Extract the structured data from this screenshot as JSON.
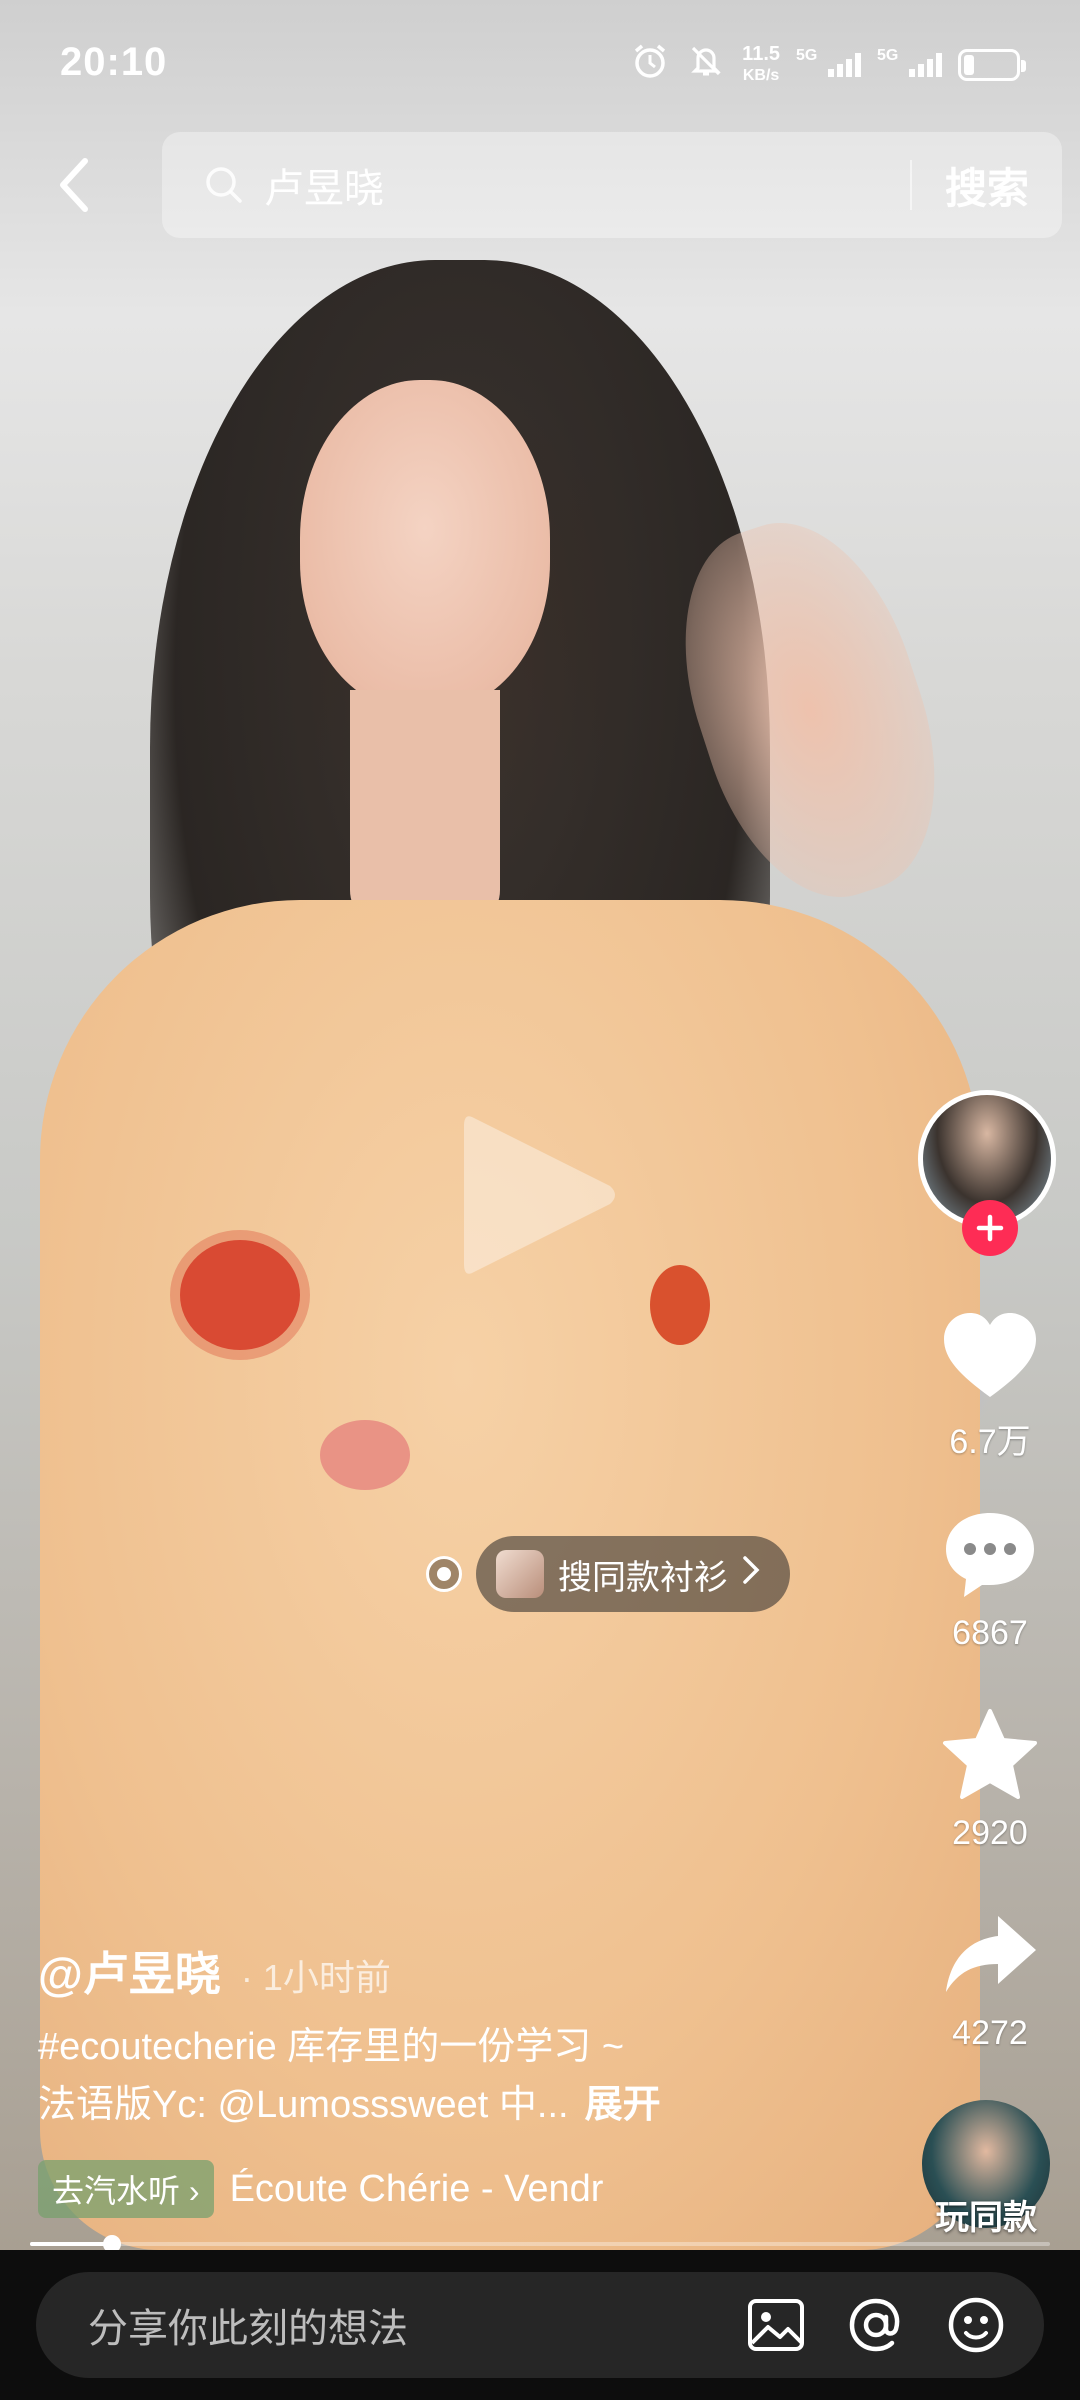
{
  "status_bar": {
    "time": "20:10",
    "net_speed_value": "11.5",
    "net_speed_unit": "KB/s",
    "sim1": "5G",
    "sim2": "5G"
  },
  "search": {
    "query": "卢昱晓",
    "button": "搜索"
  },
  "rail": {
    "likes": "6.7万",
    "comments": "6867",
    "favorites": "2920",
    "shares": "4272",
    "music_label": "玩同款"
  },
  "product_tag": {
    "label": "搜同款衬衫"
  },
  "post": {
    "author": "@卢昱晓",
    "time": "· 1小时前",
    "caption_line1": "#ecoutecherie 库存里的一份学习 ~",
    "caption_line2": "法语版Yc: @Lumosssweet 中...",
    "expand": "展开"
  },
  "music": {
    "chip": "去汽水听 ›",
    "title": "Écoute Chérie - Vendr"
  },
  "playback": {
    "progress": 0.08
  },
  "comment_bar": {
    "placeholder": "分享你此刻的想法"
  },
  "colors": {
    "accent": "#fe2c55",
    "music_chip": "#78a06e"
  }
}
